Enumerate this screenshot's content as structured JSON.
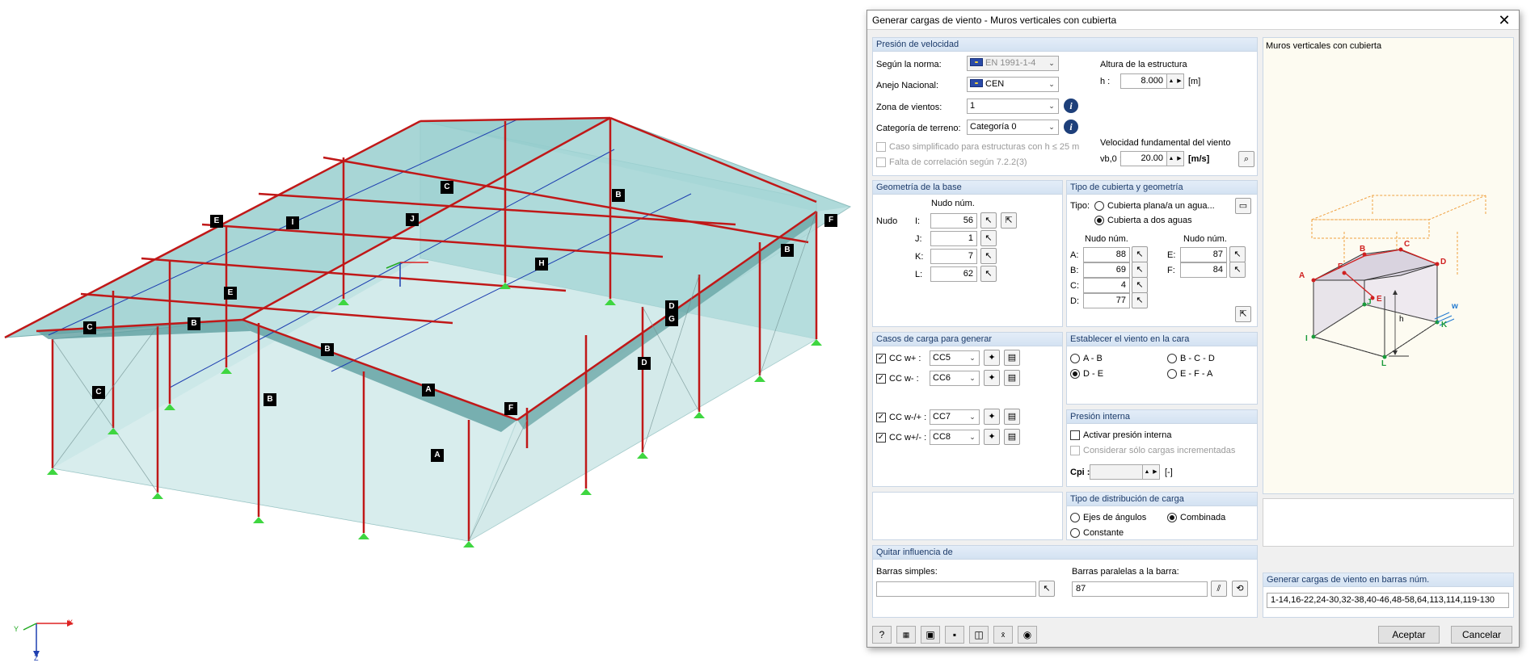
{
  "dialog": {
    "title": "Generar cargas de viento - Muros verticales con cubierta",
    "velocity": {
      "header": "Presión de velocidad",
      "standard_label": "Según la norma:",
      "standard_value": "EN 1991-1-4",
      "annex_label": "Anejo Nacional:",
      "annex_value": "CEN",
      "zone_label": "Zona de vientos:",
      "zone_value": "1",
      "terrain_label": "Categoría de terreno:",
      "terrain_value": "Categoría 0",
      "simplified_label": "Caso simplificado para estructuras con h ≤ 25 m",
      "correlation_label": "Falta de correlación según 7.2.2(3)",
      "height_title": "Altura de la estructura",
      "h_label": "h :",
      "h_value": "8.000",
      "h_unit": "[m]",
      "vb_title": "Velocidad fundamental del viento",
      "vb_label": "vb,0 :",
      "vb_value": "20.00",
      "vb_unit": "[m/s]"
    },
    "base": {
      "header": "Geometría de la base",
      "col_label": "Nudo núm.",
      "nudo_label": "Nudo",
      "rows": [
        {
          "label": "I:",
          "value": "56"
        },
        {
          "label": "J:",
          "value": "1"
        },
        {
          "label": "K:",
          "value": "7"
        },
        {
          "label": "L:",
          "value": "62"
        }
      ]
    },
    "roof": {
      "header": "Tipo de cubierta y geometría",
      "type_label": "Tipo:",
      "opt_flat": "Cubierta plana/a un agua...",
      "opt_gable": "Cubierta a dos aguas",
      "col1": "Nudo núm.",
      "col2": "Nudo núm.",
      "left": [
        {
          "label": "A:",
          "value": "88"
        },
        {
          "label": "B:",
          "value": "69"
        },
        {
          "label": "C:",
          "value": "4"
        },
        {
          "label": "D:",
          "value": "77"
        }
      ],
      "right": [
        {
          "label": "E:",
          "value": "87"
        },
        {
          "label": "F:",
          "value": "84"
        }
      ]
    },
    "cases": {
      "header": "Casos de carga para generar",
      "rows": [
        {
          "label": "CC w+ :",
          "value": "CC5"
        },
        {
          "label": "CC w- :",
          "value": "CC6"
        },
        {
          "label": "CC w-/+ :",
          "value": "CC7"
        },
        {
          "label": "CC w+/- :",
          "value": "CC8"
        }
      ]
    },
    "wind_dir": {
      "header": "Establecer el viento en la cara",
      "options": [
        "A - B",
        "B - C - D",
        "D - E",
        "E - F - A"
      ],
      "selected": "D - E"
    },
    "internal": {
      "header": "Presión interna",
      "activate_label": "Activar presión interna",
      "incremental_label": "Considerar sólo cargas incrementadas",
      "cpi_label": "Cpi :",
      "cpi_unit": "[-]"
    },
    "distribution": {
      "header": "Tipo de distribución de carga",
      "opt_axes": "Ejes de ángulos",
      "opt_combined": "Combinada",
      "opt_constant": "Constante",
      "selected": "Combinada"
    },
    "remove": {
      "header": "Quitar influencia de",
      "simple_label": "Barras simples:",
      "simple_value": "",
      "parallel_label": "Barras paralelas a la barra:",
      "parallel_value": "87"
    },
    "preview": {
      "title": "Muros verticales con cubierta",
      "labels": {
        "A": "A",
        "B": "B",
        "C": "C",
        "D": "D",
        "E": "E",
        "F": "F",
        "I": "I",
        "J": "J",
        "K": "K",
        "L": "L",
        "h": "h",
        "w": "w"
      }
    },
    "generate": {
      "header": "Generar cargas de viento en barras núm.",
      "value": "1-14,16-22,24-30,32-38,40-46,48-58,64,113,114,119-130"
    },
    "accept": "Aceptar",
    "cancel": "Cancelar",
    "colors": {
      "accent": "#1c3b6a",
      "header_bg": "#dce8f5",
      "struct_red": "#c01818",
      "panel": "#8fcaca"
    }
  },
  "model": {
    "tags": [
      "C",
      "B",
      "E",
      "I",
      "J",
      "B",
      "C",
      "H",
      "B",
      "A",
      "D",
      "G",
      "D",
      "F",
      "E",
      "B",
      "C",
      "A",
      "B",
      "F",
      "A",
      "C"
    ],
    "axis": {
      "x": "X",
      "y": "Y",
      "z": "Z"
    }
  }
}
